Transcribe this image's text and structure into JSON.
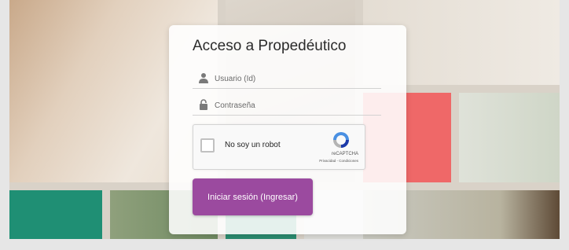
{
  "login": {
    "title": "Acceso a Propedéutico",
    "username_placeholder": "Usuario (Id)",
    "password_placeholder": "Contraseña",
    "submit_label": "Iniciar sesión (Ingresar)"
  },
  "captcha": {
    "checkbox_label": "No soy un robot",
    "brand": "reCAPTCHA",
    "links": "Privacidad - Condiciones"
  },
  "icons": {
    "user": "user-icon",
    "lock": "lock-icon",
    "recaptcha": "recaptcha-logo-icon"
  },
  "colors": {
    "primary_button": "#9b4a9f",
    "tile_red": "#ef6868",
    "tile_green": "#1f8f74"
  }
}
